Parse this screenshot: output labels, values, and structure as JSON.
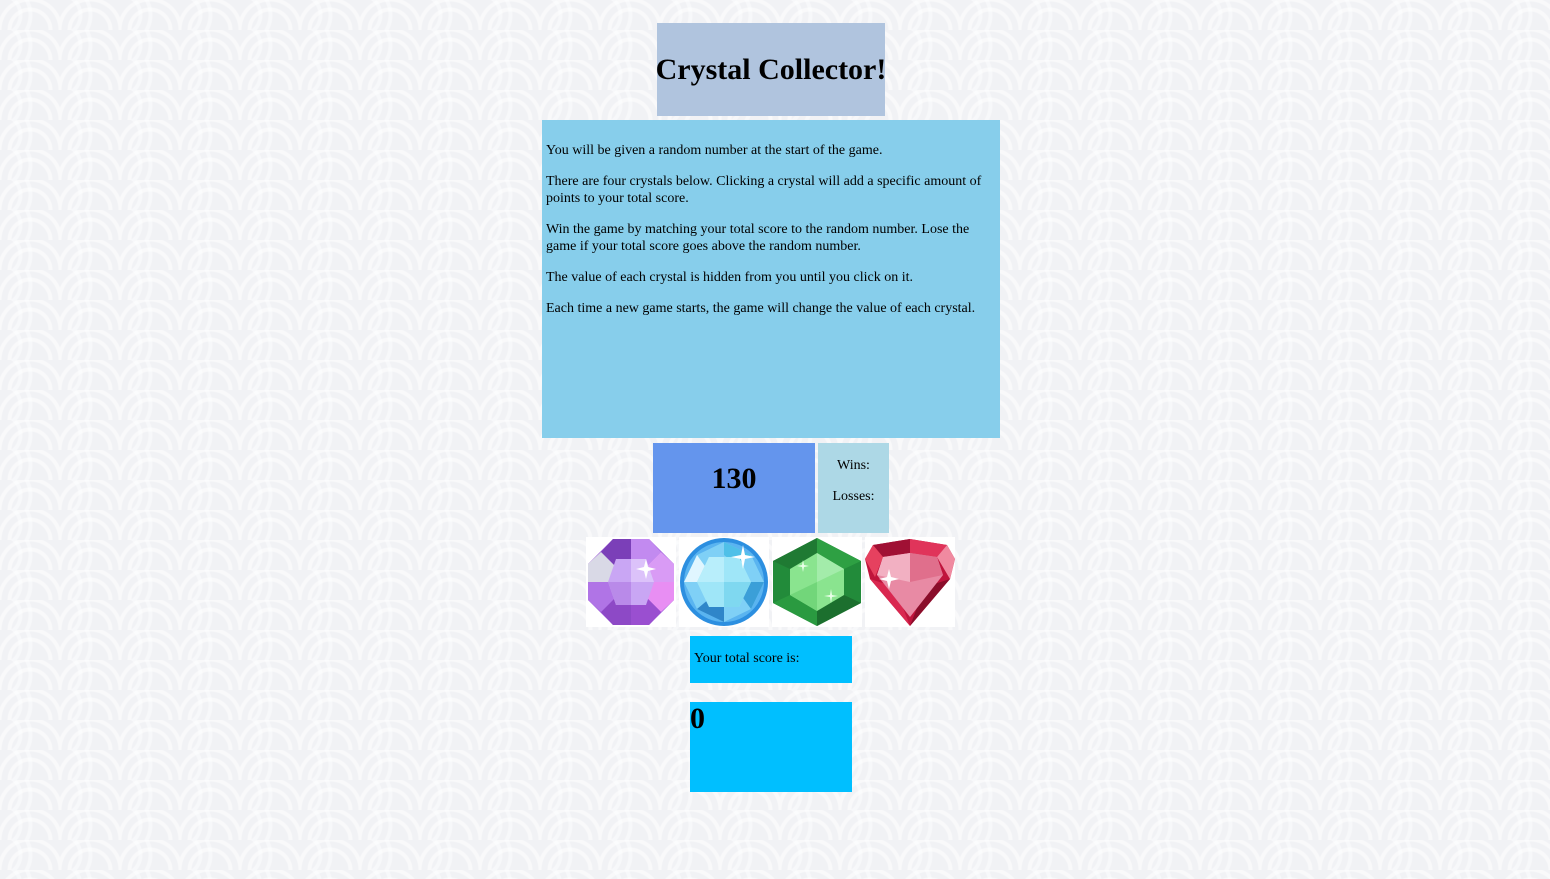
{
  "title": "Crystal Collector!",
  "instructions": [
    "You will be given a random number at the start of the game.",
    "There are four crystals below. Clicking a crystal will add a specific amount of points to your total score.",
    "Win the game by matching your total score to the random number. Lose the game if your total score goes above the random number.",
    "The value of each crystal is hidden from you until you click on it.",
    "Each time a new game starts, the game will change the value of each crystal."
  ],
  "target_number": "130",
  "record": {
    "wins_label": "Wins:",
    "losses_label": "Losses:"
  },
  "crystals": [
    {
      "name": "purple-crystal-icon",
      "color": "#a855f7"
    },
    {
      "name": "blue-crystal-icon",
      "color": "#38a9e8"
    },
    {
      "name": "green-crystal-icon",
      "color": "#2ea043"
    },
    {
      "name": "red-crystal-icon",
      "color": "#d6244a"
    }
  ],
  "score": {
    "label": "Your total score is:",
    "value": "0"
  },
  "colors": {
    "title_bg": "#b0c4de",
    "instructions_bg": "#87ceeb",
    "target_bg": "#6495ed",
    "record_bg": "#add8e6",
    "score_bg": "#00bfff"
  }
}
